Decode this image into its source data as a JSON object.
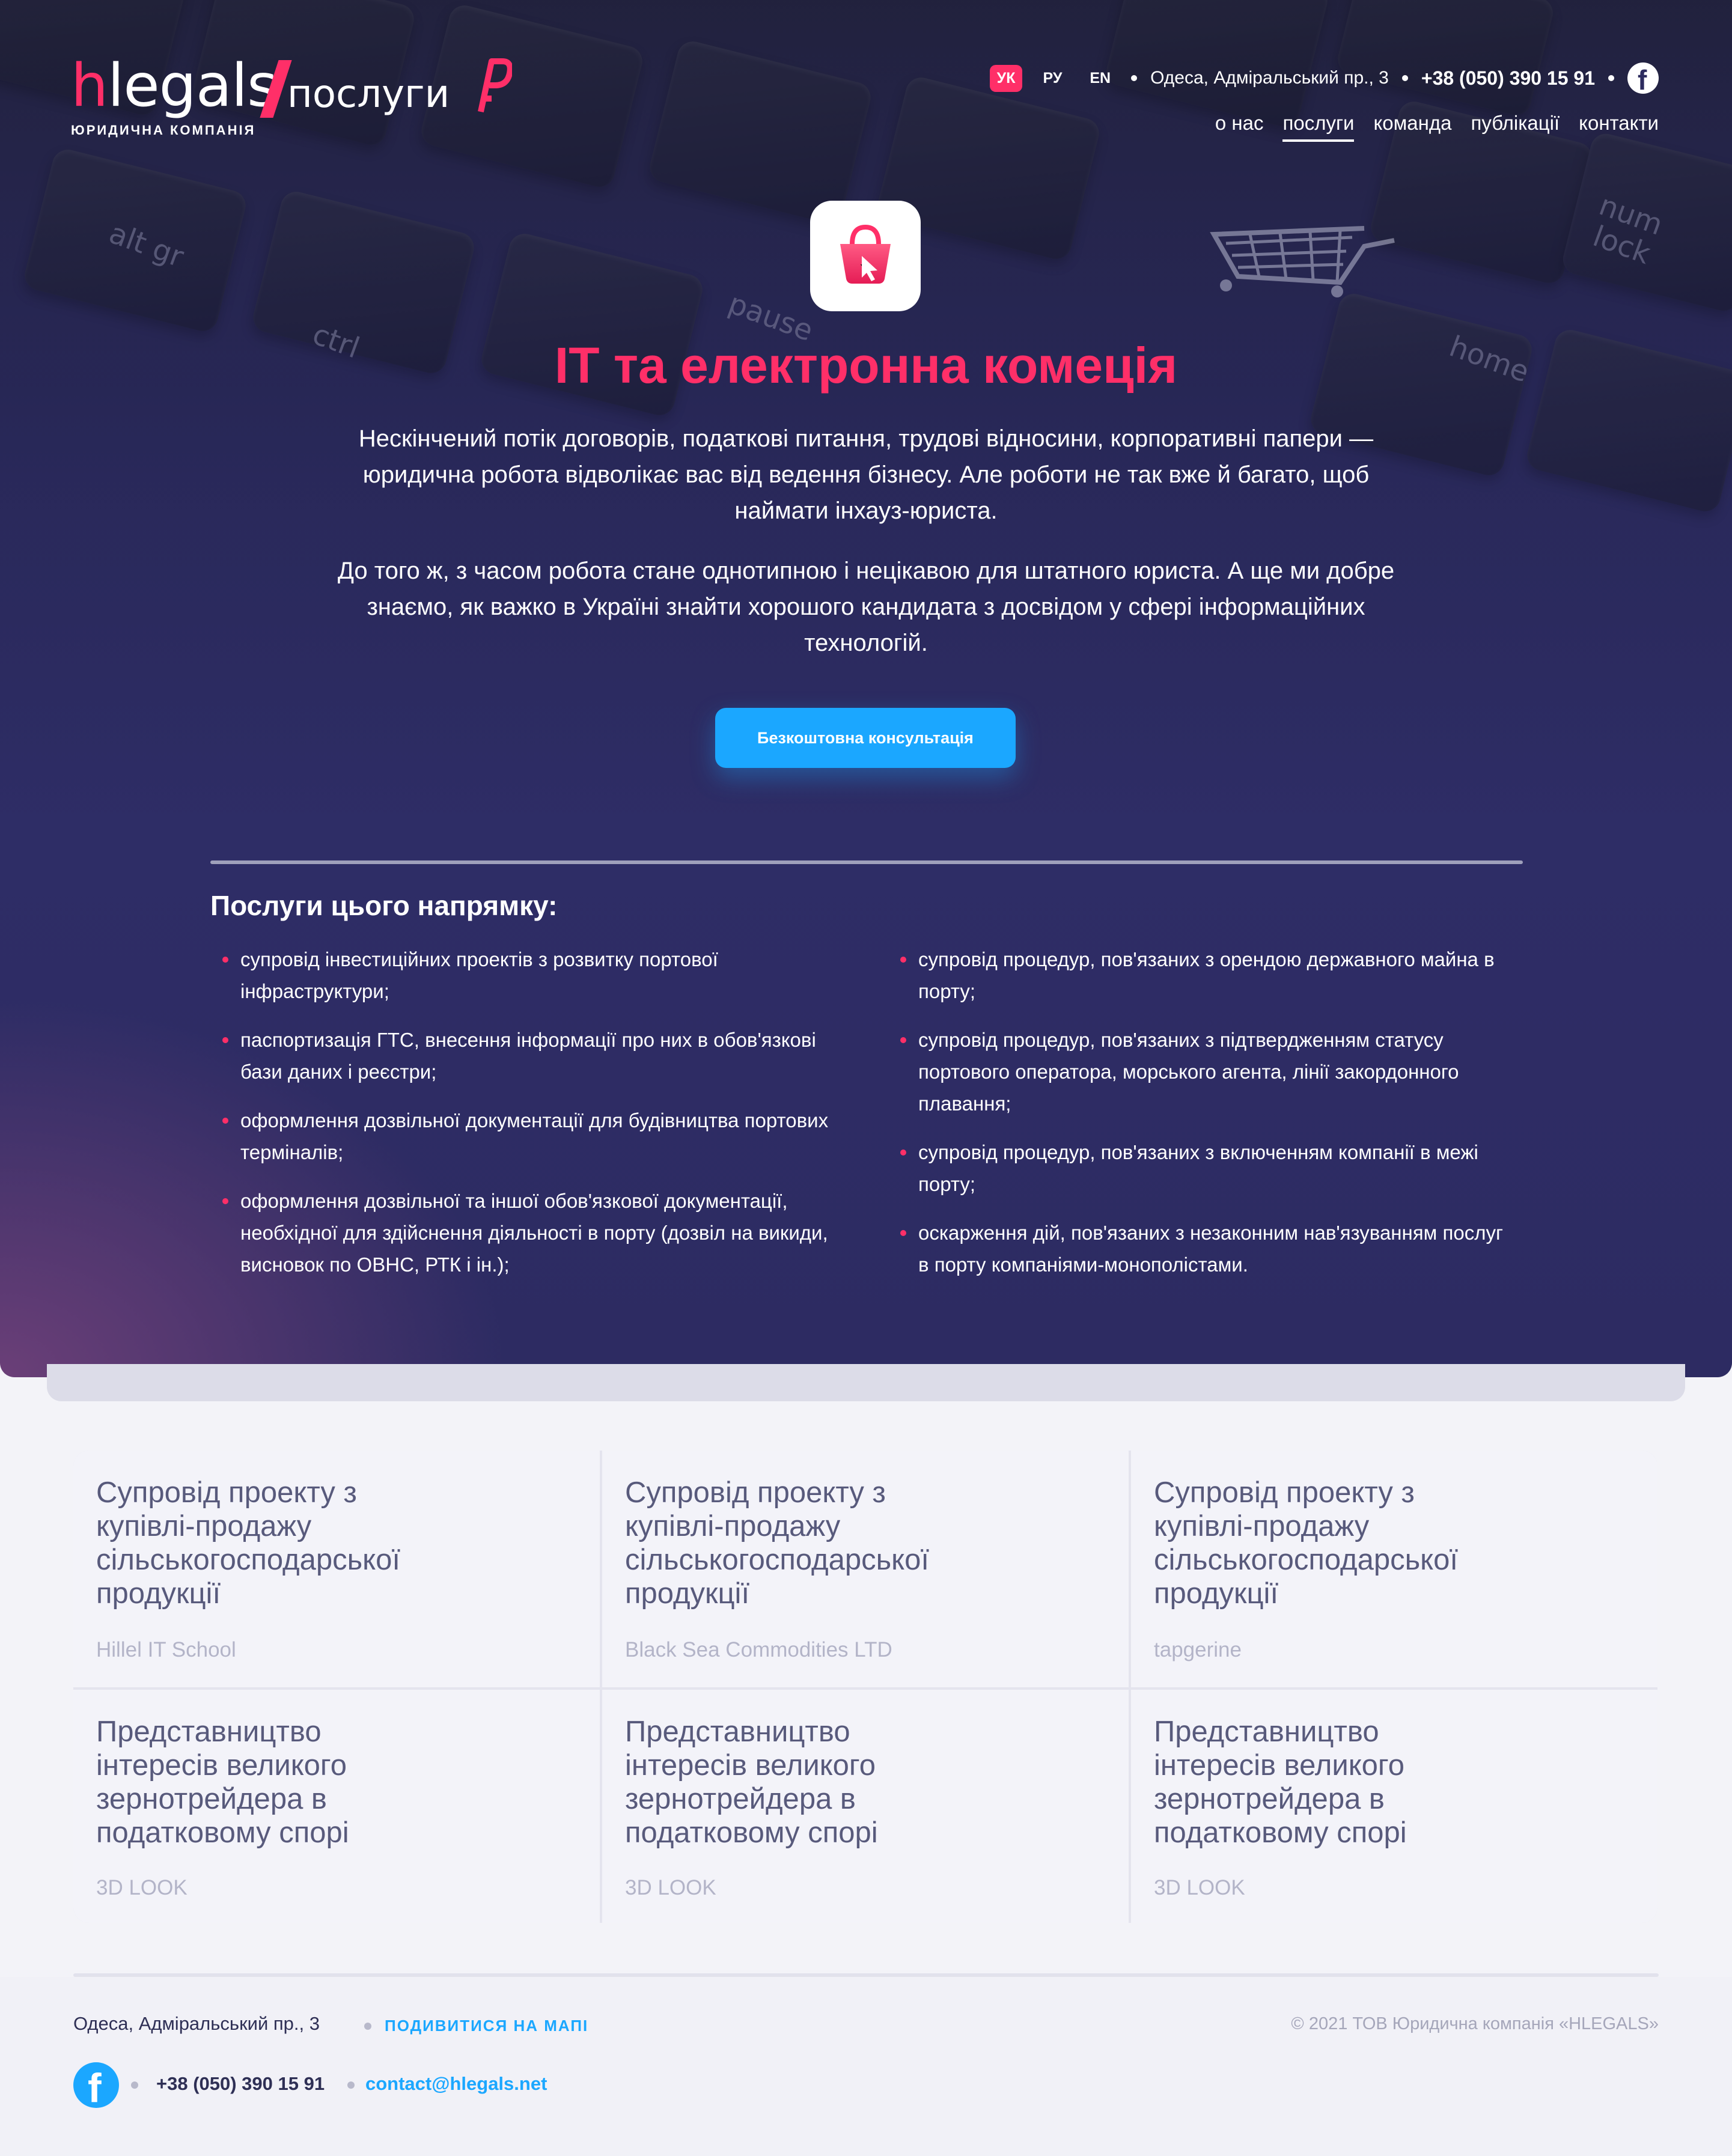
{
  "header": {
    "logo_main": "legals",
    "logo_h": "h",
    "logo_section": "послуги",
    "logo_caption": "ЮРИДИЧНА КОМПАНІЯ",
    "languages": [
      "УК",
      "РУ",
      "EN"
    ],
    "active_language": "УК",
    "address": "Одеса, Адміральський пр., 3",
    "phone": "+38 (050) 390 15 91",
    "nav": [
      "о нас",
      "послуги",
      "команда",
      "публікації",
      "контакти"
    ],
    "active_nav": "послуги"
  },
  "hero": {
    "icon": "shopping-bag-click-icon",
    "title": "IT та електронна комеція",
    "paragraph1": "Нескінчений потік договорів, податкові питання, трудові відносини, корпоративні папери — юридична робота відволікає вас від ведення бізнесу. Але роботи не так вже й багато, щоб наймати інхауз-юриста.",
    "paragraph2": "До того ж, з часом робота стане однотипною і нецікавою для штатного юриста. А ще ми добре знаємо, як важко в Україні знайти хорошого кандидата з досвідом у сфері інформаційних технологій.",
    "cta": "Безкоштовна консультація"
  },
  "services": {
    "heading": "Послуги цього напрямку:",
    "left": [
      "супровід інвестиційних проектів з розвитку портової інфраструктури;",
      "паспортизація ГТС, внесення інформації про них в обов'язкові бази даних і реєстри;",
      "оформлення дозвільної документації для будівництва портових терміналів;",
      "оформлення дозвільної та іншої обов'язкової документації, необхідної для здійснення діяльності в порту (дозвіл на викиди, висновок по ОВНС, РТК і ін.);"
    ],
    "right": [
      "супровід процедур, пов'язаних з орендою державного майна в порту;",
      "супровід процедур, пов'язаних з підтвердженням статусу портового оператора, морського агента, лінії закордонного плавання;",
      "супровід процедур, пов'язаних з включенням компанії в межі порту;",
      "оскарження дій, пов'язаних з незаконним нав'язуванням послуг в порту компаніями-монополістами."
    ]
  },
  "cases": [
    {
      "title": "Супровід проекту з купівлі-продажу сільськогосподарської продукції",
      "client": "Hillel IT School"
    },
    {
      "title": "Супровід проекту з купівлі-продажу сільськогосподарської продукції",
      "client": "Black Sea Commodities LTD"
    },
    {
      "title": "Супровід проекту з купівлі-продажу сільськогосподарської продукції",
      "client": "tapgerine"
    },
    {
      "title": "Представництво інтересів великого зернотрейдера в податковому спорі",
      "client": "3D LOOK"
    },
    {
      "title": "Представництво інтересів великого зернотрейдера в податковому спорі",
      "client": "3D LOOK"
    },
    {
      "title": "Представництво інтересів великого зернотрейдера в податковому спорі",
      "client": "3D LOOK"
    }
  ],
  "footer": {
    "address": "Одеса, Адміральський пр., 3",
    "map_link": "ПОДИВИТИСЯ НА МАПІ",
    "copyright": "© 2021 ТОВ Юридична компанія «HLEGALS»",
    "phone": "+38 (050) 390 15 91",
    "email": "contact@hlegals.net"
  },
  "colors": {
    "accent": "#ff2f68",
    "button": "#1ba7ff",
    "hero_bg": "#2d2b62",
    "footer_bg": "#f1f1f7"
  }
}
